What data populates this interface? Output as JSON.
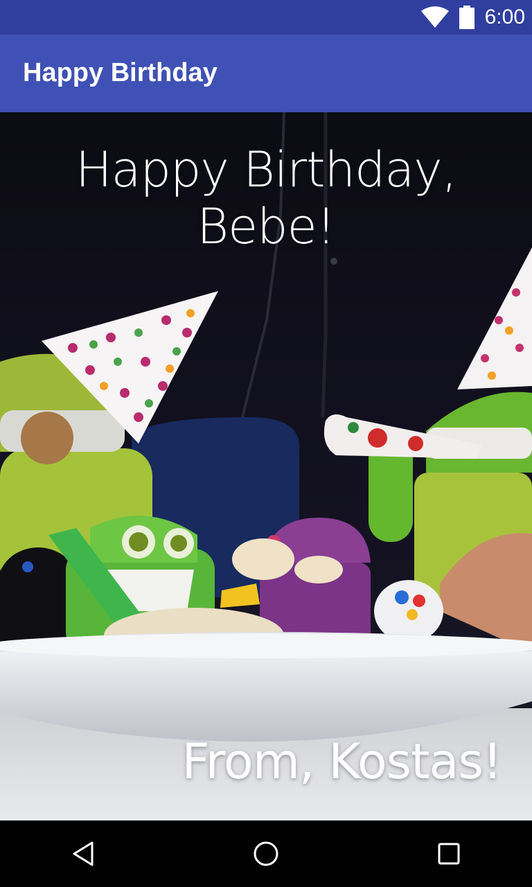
{
  "status_bar": {
    "time": "6:00",
    "icons": [
      "wifi-icon",
      "battery-icon"
    ],
    "color": "#303F9F"
  },
  "app_bar": {
    "title": "Happy Birthday",
    "color": "#3F51B5"
  },
  "card": {
    "greeting": "Happy Birthday, Bebe!",
    "signature": "From, Kostas!"
  },
  "nav_bar": {
    "icons": [
      "back-icon",
      "home-icon",
      "recents-icon"
    ]
  }
}
